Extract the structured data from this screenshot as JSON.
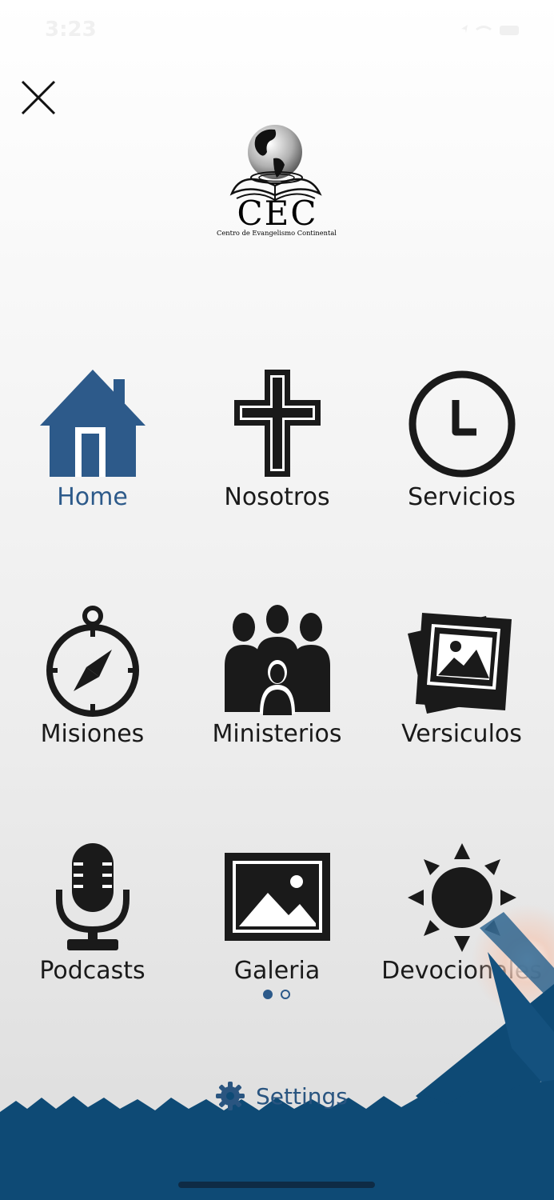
{
  "status_bar": {
    "time": "3:23",
    "icons": [
      "location-arrow-icon",
      "wifi-icon",
      "battery-icon"
    ]
  },
  "header": {
    "close_icon": "close-icon"
  },
  "logo": {
    "letters": "CEC",
    "tagline": "Centro de Evangelismo Continental",
    "icon": "globe-bible-logo"
  },
  "menu": {
    "items": [
      {
        "label": "Home",
        "icon": "house-icon",
        "active": true
      },
      {
        "label": "Nosotros",
        "icon": "cross-icon",
        "active": false
      },
      {
        "label": "Servicios",
        "icon": "clock-icon",
        "active": false
      },
      {
        "label": "Misiones",
        "icon": "compass-icon",
        "active": false
      },
      {
        "label": "Ministerios",
        "icon": "people-group-icon",
        "active": false
      },
      {
        "label": "Versiculos",
        "icon": "photos-icon",
        "active": false
      },
      {
        "label": "Podcasts",
        "icon": "microphone-icon",
        "active": false
      },
      {
        "label": "Galeria",
        "icon": "image-icon",
        "active": false
      },
      {
        "label": "Devocionales",
        "icon": "sun-icon",
        "active": false
      }
    ]
  },
  "pagination": {
    "current_page": 1,
    "total_pages": 2
  },
  "settings": {
    "label": "Settings",
    "icon": "gear-icon"
  },
  "colors": {
    "accent": "#2d5a8a",
    "icon": "#1a1a1a",
    "footer": "#0e4a75"
  }
}
